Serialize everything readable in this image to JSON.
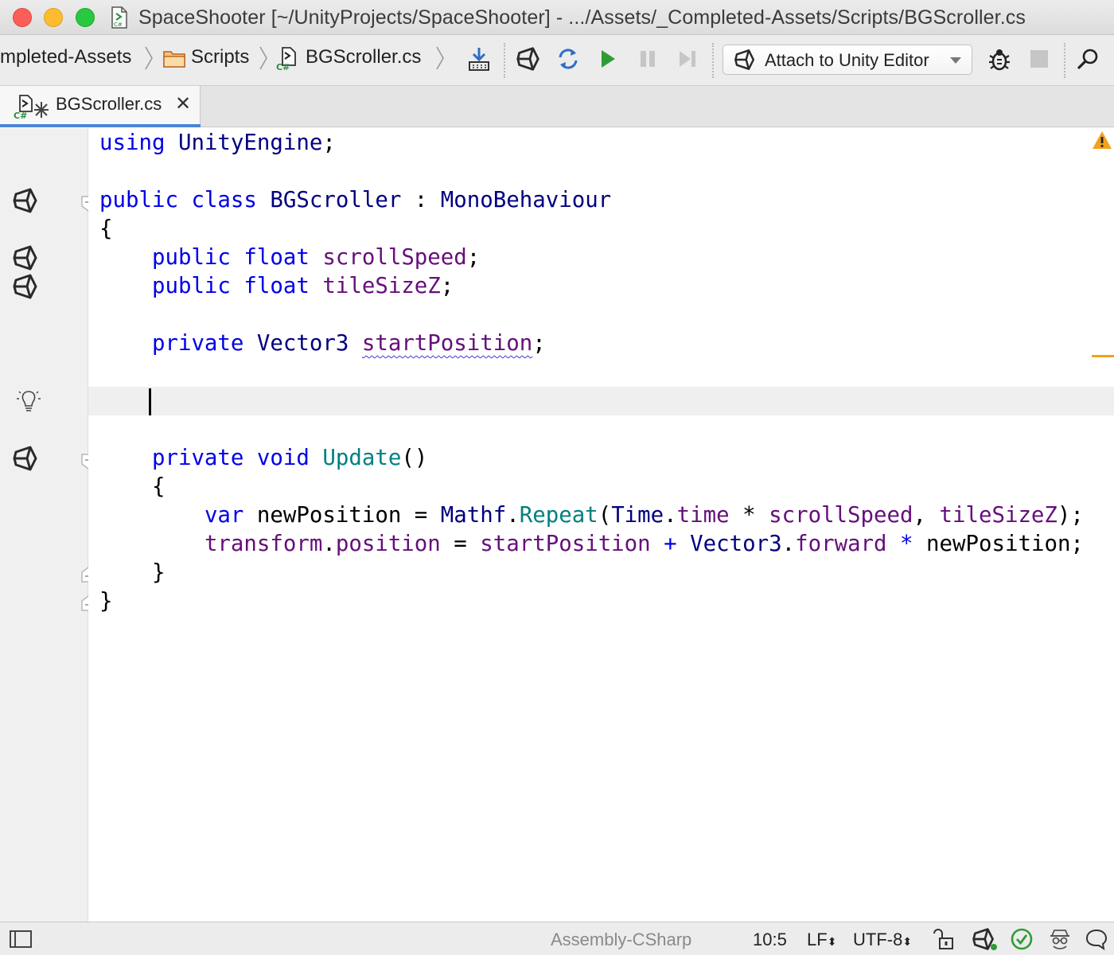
{
  "window": {
    "title": "SpaceShooter [~/UnityProjects/SpaceShooter] - .../Assets/_Completed-Assets/Scripts/BGScroller.cs"
  },
  "breadcrumbs": [
    {
      "label": "mpleted-Assets",
      "icon": "none"
    },
    {
      "label": "Scripts",
      "icon": "folder-icon"
    },
    {
      "label": "BGScroller.cs",
      "icon": "csharp-file-icon"
    }
  ],
  "toolbar": {
    "run_config_label": "Attach to Unity Editor",
    "icons": [
      "download-icon",
      "unity-icon",
      "refresh-icon",
      "run-icon",
      "pause-icon",
      "step-icon",
      "debug-icon",
      "stop-icon",
      "search-icon"
    ]
  },
  "tab": {
    "label": "BGScroller.cs",
    "close_glyph": "✕"
  },
  "code": {
    "lines": [
      "using UnityEngine;",
      "",
      "public class BGScroller : MonoBehaviour",
      "{",
      "    public float scrollSpeed;",
      "    public float tileSizeZ;",
      "",
      "    private Vector3 startPosition;",
      "",
      "    ",
      "",
      "    private void Update()",
      "    {",
      "        var newPosition = Mathf.Repeat(Time.time * scrollSpeed, tileSizeZ);",
      "        transform.position = startPosition + Vector3.forward * newPosition;",
      "    }",
      "}"
    ],
    "caret_line": 10,
    "warning_underlined_token": "startPosition"
  },
  "statusbar": {
    "project": "Assembly-CSharp",
    "position": "10:5",
    "line_ending": "LF",
    "encoding": "UTF-8",
    "icons": [
      "panel-toggle-icon",
      "lock-open-icon",
      "unity-icon",
      "check-circle-icon",
      "inspector-icon",
      "chat-icon"
    ]
  },
  "colors": {
    "keyword": "#0000e6",
    "type": "#000080",
    "field": "#660e7a",
    "method": "#008080",
    "warning": "#f3a11b",
    "run_green": "#2d9d35"
  }
}
